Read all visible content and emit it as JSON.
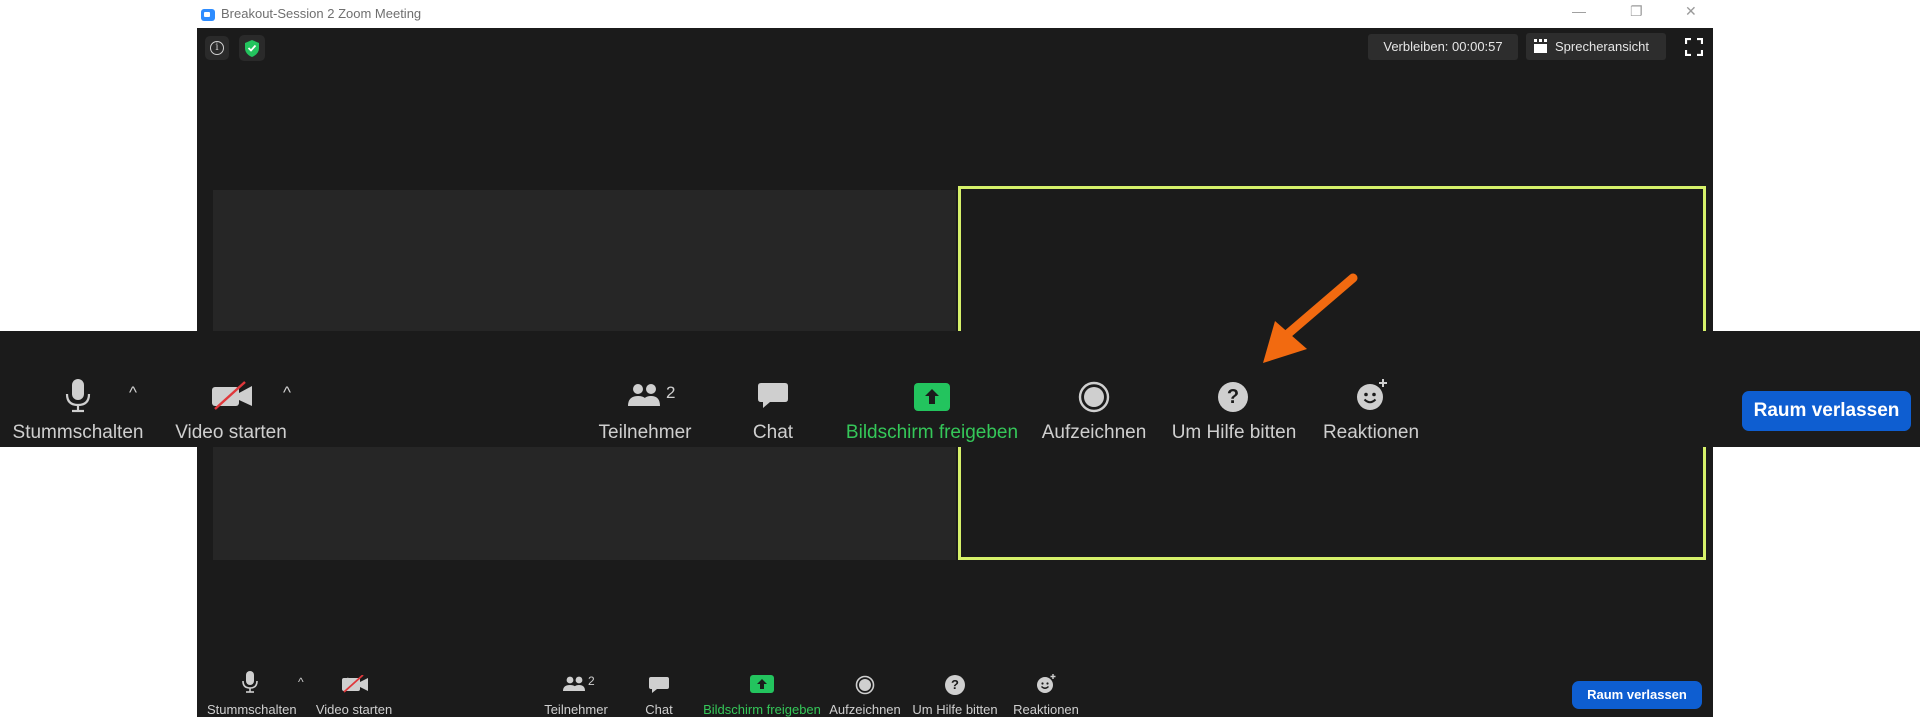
{
  "window": {
    "title": "Breakout-Session 2   Zoom Meeting",
    "minimize_glyph": "—",
    "restore_glyph": "❐",
    "close_glyph": "✕"
  },
  "top": {
    "info_glyph": "i",
    "remaining": "Verbleiben: 00:00:57",
    "view_label": "Sprecheransicht"
  },
  "toolbar": {
    "mute_label": "Stummschalten",
    "video_label": "Video starten",
    "participants_label": "Teilnehmer",
    "participants_count": "2",
    "chat_label": "Chat",
    "share_label": "Bildschirm freigeben",
    "record_label": "Aufzeichnen",
    "help_label": "Um Hilfe bitten",
    "reactions_label": "Reaktionen",
    "leave_label": "Raum verlassen",
    "help_glyph": "?",
    "caret": "^"
  },
  "colors": {
    "accent_blue": "#0e5ed1",
    "share_green": "#35c759",
    "speaker_border": "#d6f16a",
    "arrow_orange": "#f26a10"
  }
}
